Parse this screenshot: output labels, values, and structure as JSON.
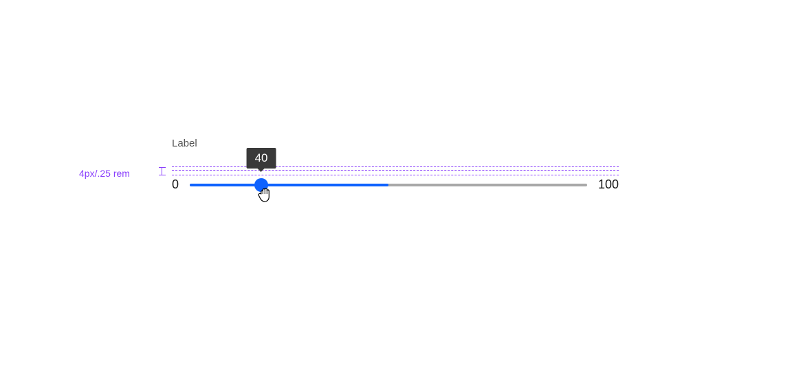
{
  "slider": {
    "label": "Label",
    "min": "0",
    "max": "100",
    "value": "40",
    "fill_percent": 50,
    "thumb_percent": 18
  },
  "annotation": {
    "spacing": "4px/.25 rem"
  },
  "colors": {
    "accent": "#0f62fe",
    "annotation": "#8a3ffc",
    "track": "#a8a8a8",
    "tooltip_bg": "#393939",
    "text_secondary": "#525252",
    "text_primary": "#161616"
  }
}
